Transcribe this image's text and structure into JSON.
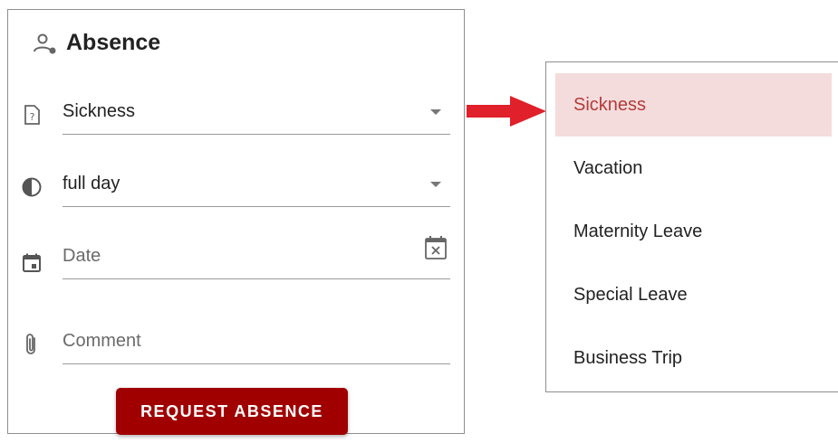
{
  "form": {
    "title": "Absence",
    "title_icon": "person-settings-icon",
    "type_field": {
      "value": "Sickness",
      "icon": "help-document-icon"
    },
    "duration_field": {
      "value": "full day",
      "icon": "half-circle-icon"
    },
    "date_field": {
      "placeholder": "Date",
      "icon": "calendar-icon",
      "clear_icon": "calendar-clear-icon"
    },
    "comment_field": {
      "placeholder": "Comment",
      "icon": "paperclip-icon"
    },
    "submit_label": "REQUEST ABSENCE"
  },
  "dropdown": {
    "options": [
      {
        "label": "Sickness",
        "selected": true
      },
      {
        "label": "Vacation",
        "selected": false
      },
      {
        "label": "Maternity Leave",
        "selected": false
      },
      {
        "label": "Special Leave",
        "selected": false
      },
      {
        "label": "Business Trip",
        "selected": false
      }
    ]
  },
  "colors": {
    "accent": "#a00000",
    "selected_bg": "#f4dcdc",
    "selected_text": "#b53a3a",
    "arrow": "#e0202a"
  }
}
